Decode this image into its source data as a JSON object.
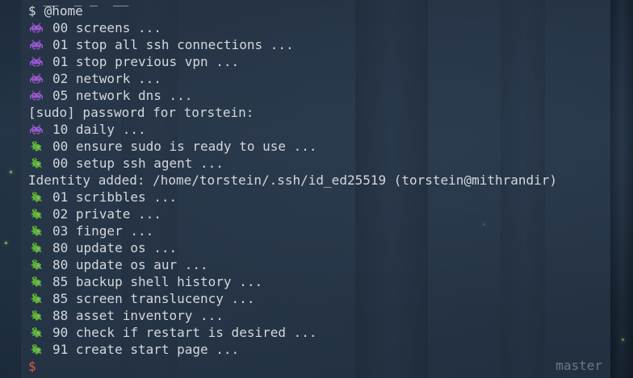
{
  "terminal": {
    "prompt_line": {
      "sign": "$",
      "text": "@home"
    },
    "lines": [
      {
        "icon": "invader-icon",
        "text": "00 screens ..."
      },
      {
        "icon": "invader-icon",
        "text": "01 stop all ssh connections ..."
      },
      {
        "icon": "invader-icon",
        "text": "01 stop previous vpn ..."
      },
      {
        "icon": "invader-icon",
        "text": "02 network ..."
      },
      {
        "icon": "invader-icon",
        "text": "05 network dns ..."
      },
      {
        "icon": "",
        "text": "[sudo] password for torstein:"
      },
      {
        "icon": "invader-icon",
        "text": "10 daily ..."
      },
      {
        "icon": "dragon-icon",
        "text": "00 ensure sudo is ready to use ..."
      },
      {
        "icon": "dragon-icon",
        "text": "00 setup ssh agent ..."
      },
      {
        "icon": "",
        "text": "Identity added: /home/torstein/.ssh/id_ed25519 (torstein@mithrandir)"
      },
      {
        "icon": "dragon-icon",
        "text": "01 scribbles ..."
      },
      {
        "icon": "dragon-icon",
        "text": "02 private ..."
      },
      {
        "icon": "dragon-icon",
        "text": "03 finger ..."
      },
      {
        "icon": "dragon-icon",
        "text": "80 update os ..."
      },
      {
        "icon": "dragon-icon",
        "text": "80 update os aur ..."
      },
      {
        "icon": "dragon-icon",
        "text": "85 backup shell history ..."
      },
      {
        "icon": "dragon-icon",
        "text": "85 screen translucency ..."
      },
      {
        "icon": "dragon-icon",
        "text": "88 asset inventory ..."
      },
      {
        "icon": "dragon-icon",
        "text": "90 check if restart is desired ..."
      },
      {
        "icon": "dragon-icon",
        "text": "91 create start page ..."
      }
    ],
    "final_prompt": {
      "sign": "$"
    },
    "git_branch": "master"
  },
  "colors": {
    "text": "#d4d7db",
    "prompt_error": "#e0584a",
    "invader": "#9b59d0",
    "dragon": "#5fae3e",
    "branch": "#6c7785"
  }
}
